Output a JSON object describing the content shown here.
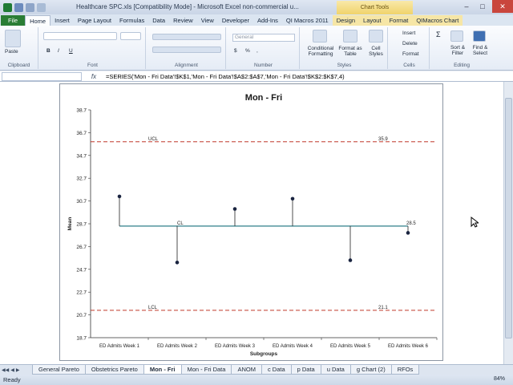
{
  "window": {
    "title": "Healthcare SPC.xls  [Compatibility Mode]  -  Microsoft Excel non-commercial u...",
    "context_tab": "Chart Tools",
    "minimize": "–",
    "maximize": "□",
    "close": "✕"
  },
  "tabs": [
    "File",
    "Home",
    "Insert",
    "Page Layout",
    "Formulas",
    "Data",
    "Review",
    "View",
    "Developer",
    "Add-Ins",
    "QI Macros 2011",
    "Design",
    "Layout",
    "Format",
    "QIMacros Chart"
  ],
  "ribbon": {
    "clipboard": {
      "name": "Clipboard",
      "paste": "Paste"
    },
    "font": {
      "name": "Font",
      "bold": "B",
      "italic": "I",
      "underline": "U"
    },
    "alignment": {
      "name": "Alignment"
    },
    "number": {
      "name": "Number",
      "format": "General",
      "currency": "$",
      "percent": "%",
      "comma": ","
    },
    "styles": {
      "name": "Styles",
      "conditional": "Conditional Formatting",
      "format_table": "Format as Table",
      "cell_styles": "Cell Styles"
    },
    "cells": {
      "name": "Cells",
      "insert": "Insert",
      "delete": "Delete",
      "format": "Format"
    },
    "editing": {
      "name": "Editing",
      "sort": "Sort & Filter",
      "find": "Find & Select"
    }
  },
  "formula_bar": {
    "fx": "fx",
    "formula": "=SERIES('Mon - Fri Data'!$K$1,'Mon - Fri Data'!$A$2:$A$7,'Mon - Fri Data'!$K$2:$K$7,4)"
  },
  "sheets": [
    "General Pareto",
    "Obstetrics Pareto",
    "Mon - Fri",
    "Mon - Fri Data",
    "ANOM",
    "c Data",
    "p Data",
    "u Data",
    "g Chart (2)",
    "RFOs"
  ],
  "active_sheet": "Mon - Fri",
  "status": {
    "ready": "Ready",
    "zoom": "84%"
  },
  "colors": {
    "limit_line": "#c0392b",
    "center_line": "#2f7f89",
    "file_tab": "#2a7d35"
  },
  "chart_data": {
    "type": "line",
    "title": "Mon - Fri",
    "xlabel": "Subgroups",
    "ylabel": "Mean",
    "categories": [
      "ED Admits Week 1",
      "ED Admits Week 2",
      "ED Admits Week 3",
      "ED Admits Week 4",
      "ED Admits Week 5",
      "ED Admits Week 6"
    ],
    "series": [
      {
        "values": [
          31.1,
          25.3,
          30.0,
          30.9,
          25.5,
          27.9
        ]
      }
    ],
    "center_line": {
      "label": "CL",
      "value": 28.5,
      "value_label": "28.5"
    },
    "upper_limit": {
      "label": "UCL",
      "value": 35.9,
      "value_label": "35.9"
    },
    "lower_limit": {
      "label": "LCL",
      "value": 21.1,
      "value_label": "21.1"
    },
    "yticks": [
      "38.7",
      "36.7",
      "34.7",
      "32.7",
      "30.7",
      "28.7",
      "26.7",
      "24.7",
      "22.7",
      "20.7",
      "18.7"
    ],
    "ylim": [
      18.7,
      38.7
    ]
  }
}
